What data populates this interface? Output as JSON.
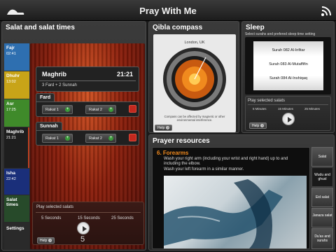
{
  "app": {
    "title": "Pray With Me"
  },
  "left_panel": {
    "title": "Salat and salat times",
    "sidebar": [
      {
        "label": "Fajr",
        "time": "02:41",
        "color": "#2e6fb0"
      },
      {
        "label": "Dhuhr",
        "time": "13:02",
        "color": "#c8a418"
      },
      {
        "label": "Asr",
        "time": "17:25",
        "color": "#3f8a2a"
      },
      {
        "label": "Maghrib",
        "time": "21:21",
        "color": "#1e1e1e"
      },
      {
        "label": "Isha",
        "time": "22:42",
        "color": "#1a2f7a"
      },
      {
        "label": "Salat times",
        "time": "",
        "color": "#274a2a"
      },
      {
        "label": "Settings",
        "time": "",
        "color": "#2a2a2a"
      }
    ],
    "selected": {
      "name": "Maghrib",
      "time": "21:21",
      "subtitle": "3 Fard + 2 Sunnah"
    },
    "fard": {
      "label": "Fard",
      "rakat1": "Rakat 1",
      "rakat2": "Rakat 2"
    },
    "sunnah": {
      "label": "Sunnah",
      "rakat1": "Rakat 1",
      "rakat2": "Rakat 2"
    },
    "play": {
      "title": "Play selected salats",
      "options": [
        "5 Seconds",
        "15 Seconds",
        "25 Seconds"
      ],
      "count": "5",
      "help": "Help"
    }
  },
  "qibla": {
    "title": "Qibla compass",
    "location": "London, UK",
    "note": "Compass can be affected by magnetic or other environmental interference.",
    "help": "Help"
  },
  "sleep": {
    "title": "Sleep",
    "instruction": "Select surahs and prefered sleep time setting",
    "surahs": [
      "Surah 082 Al-Infitar",
      "Surah 083 Al-Mutaffifin",
      "Surah 084 Al-Inshiqaq"
    ],
    "play_title": "Play selected salats",
    "options": [
      "5 Minutes",
      "15 Minutes",
      "25 Minutes"
    ],
    "help": "Help"
  },
  "resources": {
    "title": "Prayer resources",
    "step_title": "6. Forearms",
    "step_text1": "Wash your right arm (including your wrist and right hand) up to and including the elbow.",
    "step_text2": "Wash your left forearm in a similar manner.",
    "tabs": [
      "Salat",
      "Wudu and ghusl",
      "Eid salat",
      "Janaza salat",
      "Du'as and surahs"
    ]
  }
}
